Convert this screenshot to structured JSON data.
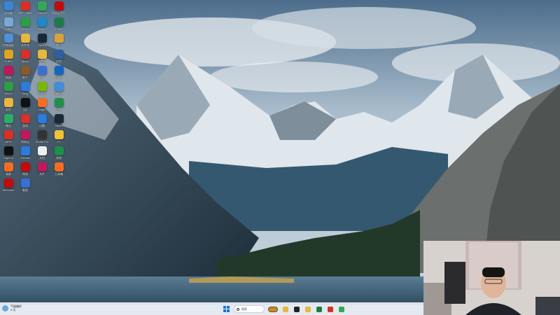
{
  "desktop": {
    "icons": [
      {
        "label": "此电脑",
        "icon": "computer-icon",
        "color": "#3a86d6"
      },
      {
        "label": "WPS Office",
        "icon": "wps-icon",
        "color": "#d93025"
      },
      {
        "label": "Chrome",
        "icon": "chrome-icon",
        "color": "#34a853"
      },
      {
        "label": "网易云音乐",
        "icon": "music-icon",
        "color": "#c20c0c"
      },
      {
        "label": "回收站",
        "icon": "recycle-bin-icon",
        "color": "#7aa7d8"
      },
      {
        "label": "GeForce",
        "icon": "geforce-icon",
        "color": "#2e9e45"
      },
      {
        "label": "Edge",
        "icon": "edge-icon",
        "color": "#1e88c9"
      },
      {
        "label": "Excel",
        "icon": "excel-icon",
        "color": "#1e7b45"
      },
      {
        "label": "控制面板",
        "icon": "control-panel-icon",
        "color": "#4f8fd8"
      },
      {
        "label": "文件夹",
        "icon": "folder-icon",
        "color": "#e9b63e"
      },
      {
        "label": "Steam",
        "icon": "steam-icon",
        "color": "#1b2838"
      },
      {
        "label": "图片",
        "icon": "image-icon",
        "color": "#d8a43a"
      },
      {
        "label": "PUBG",
        "icon": "game-icon",
        "color": "#e0a41f"
      },
      {
        "label": "Mario",
        "icon": "mario-icon",
        "color": "#d8302b"
      },
      {
        "label": "文件夹",
        "icon": "folder-icon",
        "color": "#e9b63e"
      },
      {
        "label": "应用",
        "icon": "app-icon",
        "color": "#2f5fa0"
      },
      {
        "label": "网易",
        "icon": "netease-icon",
        "color": "#c2185b"
      },
      {
        "label": "助手",
        "icon": "assistant-icon",
        "color": "#8b5a2b"
      },
      {
        "label": "EA",
        "icon": "ea-icon",
        "color": "#3a6fd8"
      },
      {
        "label": "Edge",
        "icon": "edge-icon",
        "color": "#1565c0"
      },
      {
        "label": "XBOX",
        "icon": "xbox-icon",
        "color": "#2e9e45"
      },
      {
        "label": "Bing",
        "icon": "bing-icon",
        "color": "#2b7be0"
      },
      {
        "label": "NVIDIA",
        "icon": "nvidia-icon",
        "color": "#76b900"
      },
      {
        "label": "Android",
        "icon": "android-icon",
        "color": "#3f8fd8"
      },
      {
        "label": "文件",
        "icon": "folder-icon",
        "color": "#e9b63e"
      },
      {
        "label": "QQ",
        "icon": "qq-icon",
        "color": "#111111"
      },
      {
        "label": "Origin",
        "icon": "origin-icon",
        "color": "#f56c23"
      },
      {
        "label": "工具",
        "icon": "tool-icon",
        "color": "#1f8f4a"
      },
      {
        "label": "微信",
        "icon": "wechat-icon",
        "color": "#2aae67"
      },
      {
        "label": "游戏",
        "icon": "game-icon",
        "color": "#d8302b"
      },
      {
        "label": "迅雷",
        "icon": "thunder-icon",
        "color": "#2b7be0"
      },
      {
        "label": "Steam",
        "icon": "steam-icon",
        "color": "#1b2838"
      },
      {
        "label": "WPS",
        "icon": "wps-icon",
        "color": "#d93025"
      },
      {
        "label": "网易云",
        "icon": "music-icon",
        "color": "#c2185b"
      },
      {
        "label": "Studio Pro",
        "icon": "studio-icon",
        "color": "#333333"
      },
      {
        "label": "YY",
        "icon": "yy-icon",
        "color": "#f1c232"
      },
      {
        "label": "CapCut",
        "icon": "capcut-icon",
        "color": "#111111"
      },
      {
        "label": "ToDesk",
        "icon": "todesk-icon",
        "color": "#2b7be0"
      },
      {
        "label": "文档",
        "icon": "document-icon",
        "color": "#eeeeee"
      },
      {
        "label": "表格",
        "icon": "sheet-icon",
        "color": "#1f8f4a"
      },
      {
        "label": "录屏",
        "icon": "recorder-icon",
        "color": "#f56c23"
      },
      {
        "label": "网易",
        "icon": "netease-icon",
        "color": "#c20c0c"
      },
      {
        "label": "文件",
        "icon": "file-icon",
        "color": "#c2185b"
      },
      {
        "label": "工具箱",
        "icon": "toolbox-icon",
        "color": "#f56c23"
      },
      {
        "label": "WeGame",
        "icon": "wegame-icon",
        "color": "#c20c0c"
      },
      {
        "label": "截图",
        "icon": "screenshot-icon",
        "color": "#3a6fd8"
      }
    ]
  },
  "taskbar": {
    "weather": {
      "temp": "气候偏好",
      "line2": "3 天"
    },
    "search_label": "搜索",
    "apps": [
      {
        "icon": "file-explorer-icon",
        "color": "#e9b63e"
      },
      {
        "icon": "terminal-icon",
        "color": "#222222"
      },
      {
        "icon": "folder-icon",
        "color": "#e9b63e"
      },
      {
        "icon": "excel-icon",
        "color": "#1e7b45"
      },
      {
        "icon": "wps-icon",
        "color": "#d93025"
      },
      {
        "icon": "chrome-icon",
        "color": "#34a853"
      }
    ]
  },
  "colors": {
    "taskbar_bg": "#e6ecf2",
    "accent": "#1a73d9"
  }
}
